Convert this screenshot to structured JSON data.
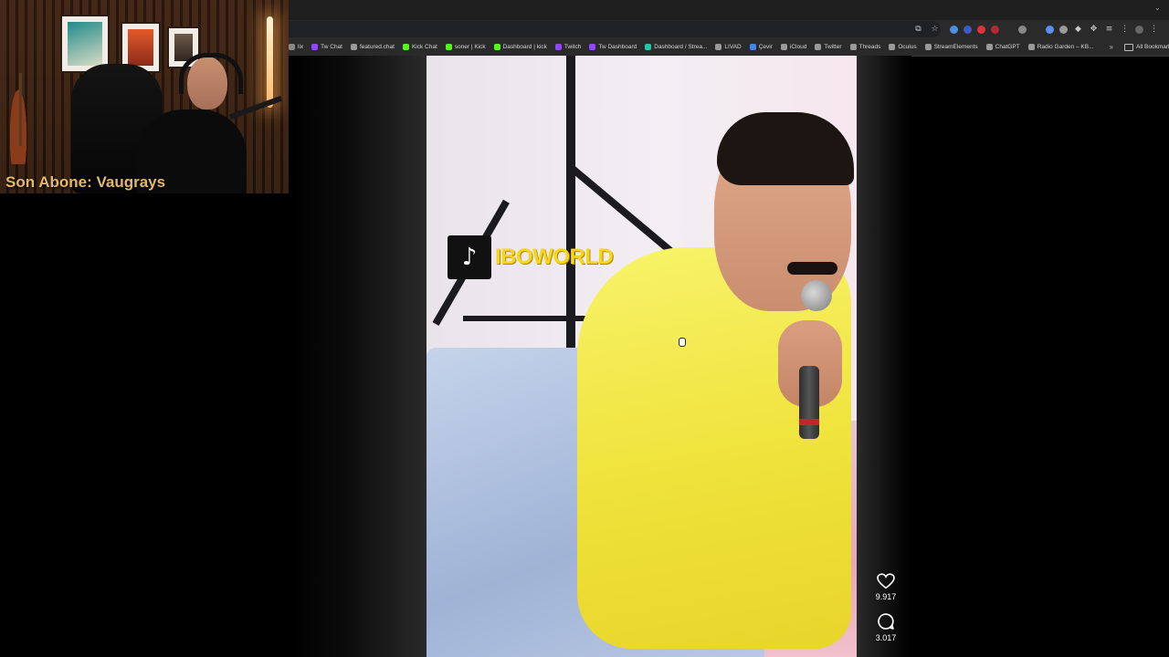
{
  "webcam": {
    "subscriber_label": "Son Abone: Vaugrays"
  },
  "browser": {
    "url_actions": [
      "install-icon",
      "star-icon"
    ],
    "bookmarks": [
      {
        "label": "lix",
        "color": "#888888"
      },
      {
        "label": "Tw Chat",
        "color": "#9146ff"
      },
      {
        "label": "featured.chat",
        "color": "#9a9a9a"
      },
      {
        "label": "Kick Chat",
        "color": "#53fc18"
      },
      {
        "label": "soner | Kick",
        "color": "#53fc18"
      },
      {
        "label": "Dashboard | kick",
        "color": "#53fc18"
      },
      {
        "label": "Twitch",
        "color": "#9146ff"
      },
      {
        "label": "Tw Dashboard",
        "color": "#9146ff"
      },
      {
        "label": "Dashboard / Strea...",
        "color": "#22c7a9"
      },
      {
        "label": "LIVAD",
        "color": "#9a9a9a"
      },
      {
        "label": "Çevir",
        "color": "#4285f4"
      },
      {
        "label": "iCloud",
        "color": "#9a9a9a"
      },
      {
        "label": "Twitter",
        "color": "#9a9a9a"
      },
      {
        "label": "Threads",
        "color": "#9a9a9a"
      },
      {
        "label": "Oculus",
        "color": "#9a9a9a"
      },
      {
        "label": "StreamElements",
        "color": "#9a9a9a"
      },
      {
        "label": "ChatGPT",
        "color": "#9a9a9a"
      },
      {
        "label": "Radio Garden – KB...",
        "color": "#9a9a9a"
      }
    ],
    "more_symbol": "»",
    "all_bookmarks": "All Bookmarks"
  },
  "video": {
    "watermark_text": "IBOWORLD"
  },
  "actions": {
    "like_count": "9.917",
    "comment_count": "3.017"
  }
}
